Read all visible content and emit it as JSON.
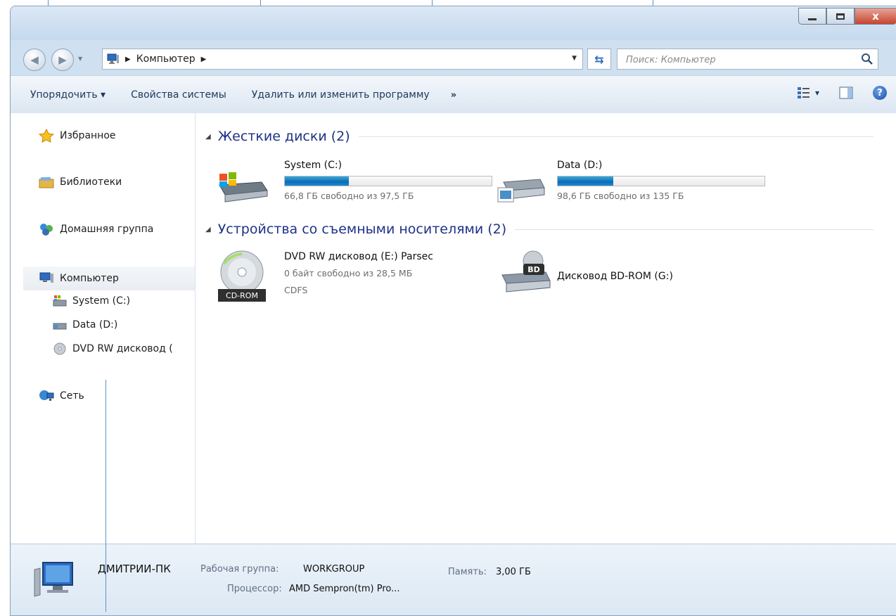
{
  "window": {
    "controls": [
      "minimize",
      "maximize",
      "close"
    ],
    "close_glyph": "x"
  },
  "nav": {
    "back_glyph": "◀",
    "forward_glyph": "▶",
    "recent_glyph": "▼"
  },
  "address": {
    "icon": "computer-icon",
    "path": [
      "Компьютер"
    ],
    "dropdown_glyph": "▼"
  },
  "search": {
    "placeholder": "Поиск: Компьютер",
    "icon": "search-icon"
  },
  "toolbar": {
    "organize": "Упорядочить ▾",
    "system_properties": "Свойства системы",
    "uninstall": "Удалить или изменить программу",
    "more": "»",
    "view_dropdown": "▾",
    "help": "?"
  },
  "sidebar": {
    "items": [
      {
        "label": "Избранное",
        "icon": "star-icon"
      },
      {
        "label": "Библиотеки",
        "icon": "libraries-icon"
      },
      {
        "label": "Домашняя группа",
        "icon": "homegroup-icon"
      },
      {
        "label": "Компьютер",
        "icon": "computer-icon",
        "selected": true
      },
      {
        "label": "System (C:)",
        "icon": "drive-c-icon"
      },
      {
        "label": "Data (D:)",
        "icon": "drive-d-icon"
      },
      {
        "label": "DVD RW дисковод (",
        "icon": "dvd-icon"
      },
      {
        "label": "Сеть",
        "icon": "network-icon"
      }
    ]
  },
  "groups": {
    "hard_disks": {
      "title": "Жесткие диски (2)",
      "drives": [
        {
          "name": "System (C:)",
          "free": "66,8 ГБ свободно из 97,5 ГБ",
          "used_fraction": 0.31,
          "icon": "windows-drive-icon"
        },
        {
          "name": "Data (D:)",
          "free": "98,6 ГБ свободно из 135 ГБ",
          "used_fraction": 0.27,
          "icon": "hard-drive-icon"
        }
      ]
    },
    "removable": {
      "title": "Устройства со съемными носителями (2)",
      "devices": [
        {
          "name": "DVD RW дисковод (E:) Parsec",
          "free": "0 байт свободно из 28,5 МБ",
          "fs": "CDFS",
          "badge": "CD-ROM",
          "icon": "cd-rom-icon"
        },
        {
          "name": "Дисковод BD-ROM (G:)",
          "badge": "BD",
          "icon": "bd-rom-icon"
        }
      ]
    }
  },
  "details": {
    "computer_name": "ДМИТРИИ-ПК",
    "workgroup_label": "Рабочая группа:",
    "workgroup_value": "WORKGROUP",
    "memory_label": "Память:",
    "memory_value": "3,00 ГБ",
    "processor_label": "Процессор:",
    "processor_value": "AMD Sempron(tm) Pro..."
  },
  "colors": {
    "accent": "#1e3287",
    "bar_fill": "#1279c0",
    "toolbar_text": "#1e395b"
  }
}
